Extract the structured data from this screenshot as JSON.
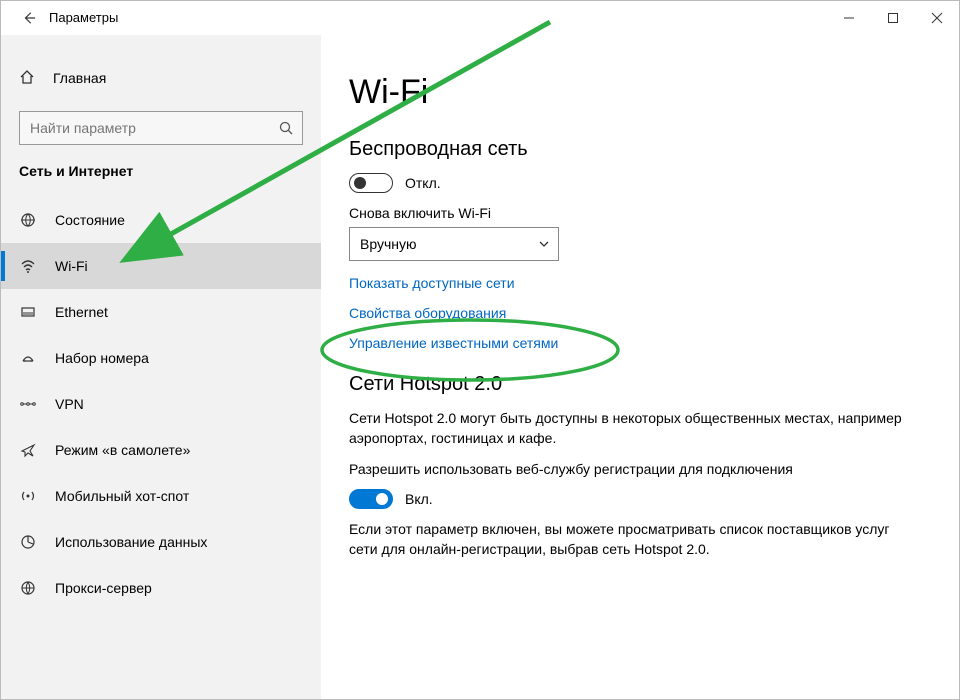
{
  "titlebar": {
    "title": "Параметры"
  },
  "sidebar": {
    "home": "Главная",
    "search_placeholder": "Найти параметр",
    "category": "Сеть и Интернет",
    "items": [
      {
        "label": "Состояние"
      },
      {
        "label": "Wi-Fi"
      },
      {
        "label": "Ethernet"
      },
      {
        "label": "Набор номера"
      },
      {
        "label": "VPN"
      },
      {
        "label": "Режим «в самолете»"
      },
      {
        "label": "Мобильный хот-спот"
      },
      {
        "label": "Использование данных"
      },
      {
        "label": "Прокси-сервер"
      }
    ]
  },
  "content": {
    "page_title": "Wi-Fi",
    "wireless": {
      "heading": "Беспроводная сеть",
      "toggle_status": "Откл.",
      "reenable_label": "Снова включить Wi-Fi",
      "dropdown_value": "Вручную"
    },
    "links": {
      "show_networks": "Показать доступные сети",
      "hw_props": "Свойства оборудования",
      "manage_known": "Управление известными сетями"
    },
    "hotspot": {
      "heading": "Сети Hotspot 2.0",
      "desc": "Сети Hotspot 2.0 могут быть доступны в некоторых общественных местах, например аэропортах, гостиницах и кафе.",
      "allow": "Разрешить использовать веб-службу регистрации для подключения",
      "toggle_status": "Вкл.",
      "note": "Если этот параметр включен, вы можете просматривать список поставщиков услуг сети для онлайн-регистрации, выбрав сеть Hotspot 2.0."
    }
  },
  "annotation_color": "#2fae45"
}
